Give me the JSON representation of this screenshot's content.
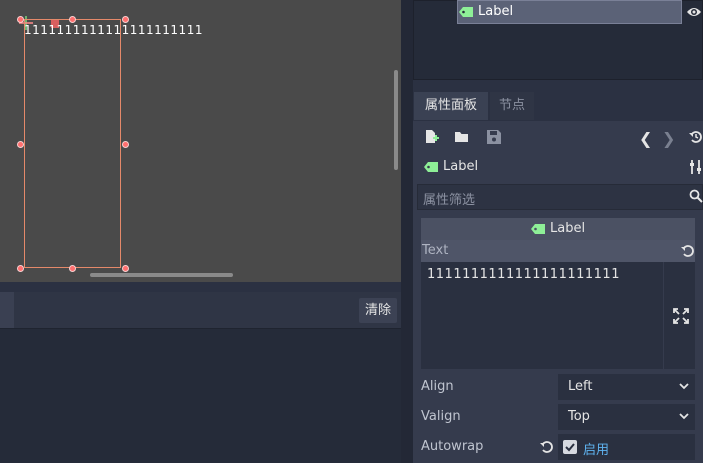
{
  "viewport": {
    "label_text": "1111111111111111111111"
  },
  "output": {
    "clear_label": "清除"
  },
  "scene_tree": {
    "selected_node": "Label"
  },
  "inspector": {
    "tabs": [
      {
        "label": "属性面板"
      },
      {
        "label": "节点"
      }
    ],
    "toolbar": {
      "back": "❮",
      "forward": "❯"
    },
    "object_name": "Label",
    "filter_placeholder": "属性筛选",
    "section_title": "Label",
    "properties": {
      "text_label": "Text",
      "text_value": "1111111111111111111111",
      "align_label": "Align",
      "align_value": "Left",
      "valign_label": "Valign",
      "valign_value": "Top",
      "autowrap_label": "Autowrap",
      "autowrap_value": "启用",
      "autowrap_checked": true
    }
  },
  "colors": {
    "editor_bg": "#2b3142",
    "viewport_bg": "#4a4a4a",
    "selection_outline": "#e5896a",
    "label_node_icon": "#8eef97",
    "accent_blue": "#5fb3f0"
  },
  "icons": {
    "label_node": "label-node-icon",
    "visibility": "eye-icon",
    "new_resource": "new-resource-icon",
    "open": "folder-open-icon",
    "save": "save-icon",
    "history": "history-icon",
    "tools": "tools-icon",
    "search": "search-icon",
    "revert": "revert-icon",
    "expand": "expand-icon",
    "dropdown": "chevron-down-icon",
    "checkbox": "checkbox-checked-icon"
  }
}
